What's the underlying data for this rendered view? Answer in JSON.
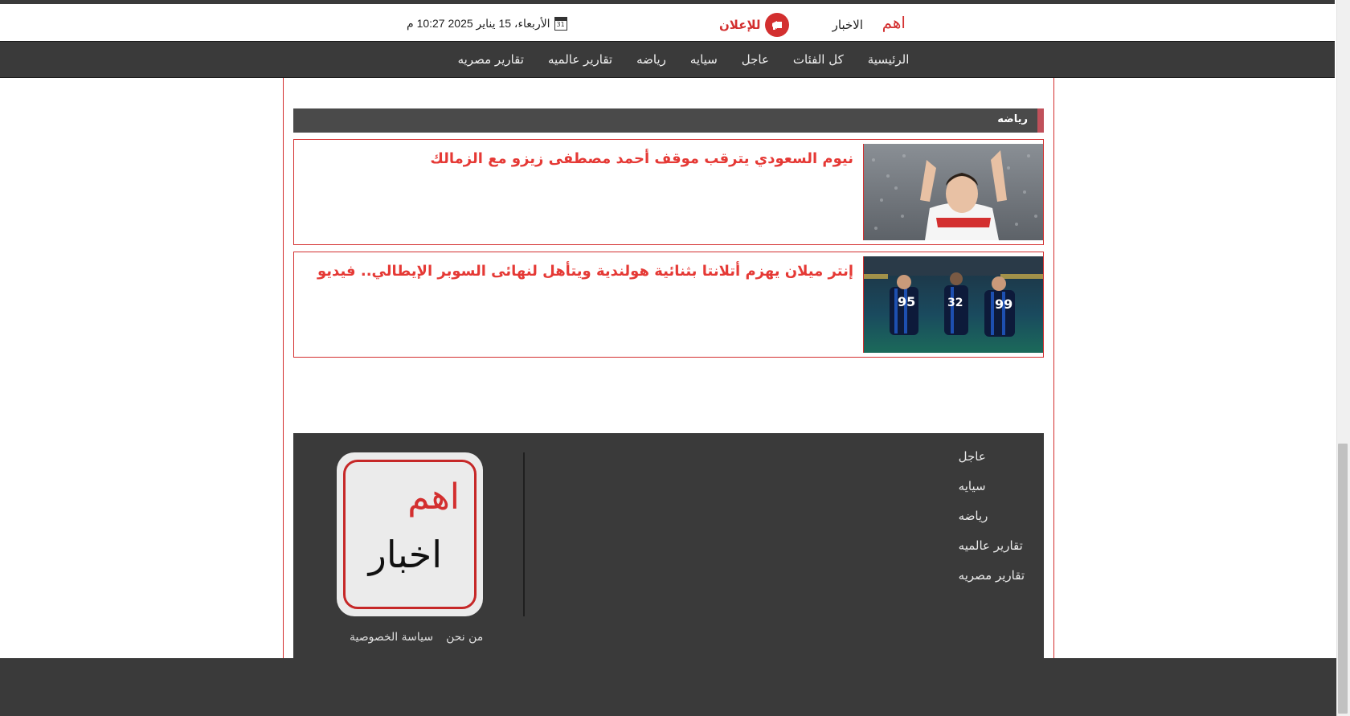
{
  "header": {
    "logo_main": "اهم",
    "logo_sub": "الاخبار",
    "ad_label": "للإعلان",
    "calendar_day": "31",
    "date_text": "الأربعاء، 15 يناير 2025 10:27 م"
  },
  "nav": {
    "items": [
      {
        "label": "الرئيسية"
      },
      {
        "label": "كل الفئات"
      },
      {
        "label": "عاجل"
      },
      {
        "label": "سيايه"
      },
      {
        "label": "رياضه"
      },
      {
        "label": "تقارير عالميه"
      },
      {
        "label": "تقارير مصريه"
      }
    ]
  },
  "section": {
    "title": "رياضه"
  },
  "articles": [
    {
      "title": "نيوم السعودي يترقب موقف أحمد مصطفى زيزو مع الزمالك"
    },
    {
      "title": "إنتر ميلان يهزم أتلانتا بثنائية هولندية ويتأهل لنهائى السوبر الإيطالي.. فيديو",
      "jersey_numbers": [
        "95",
        "32",
        "99"
      ]
    }
  ],
  "footer": {
    "links": [
      {
        "label": "عاجل"
      },
      {
        "label": "سيايه"
      },
      {
        "label": "رياضه"
      },
      {
        "label": "تقارير عالميه"
      },
      {
        "label": "تقارير مصريه"
      }
    ],
    "logo_main": "اهم",
    "logo_sub": "اخبار",
    "about_label": "من نحن",
    "privacy_label": "سياسة الخصوصية"
  },
  "colors": {
    "accent": "#d32f2f",
    "nav_bg": "#3a3a3a",
    "section_bar": "#4a4a4a"
  }
}
